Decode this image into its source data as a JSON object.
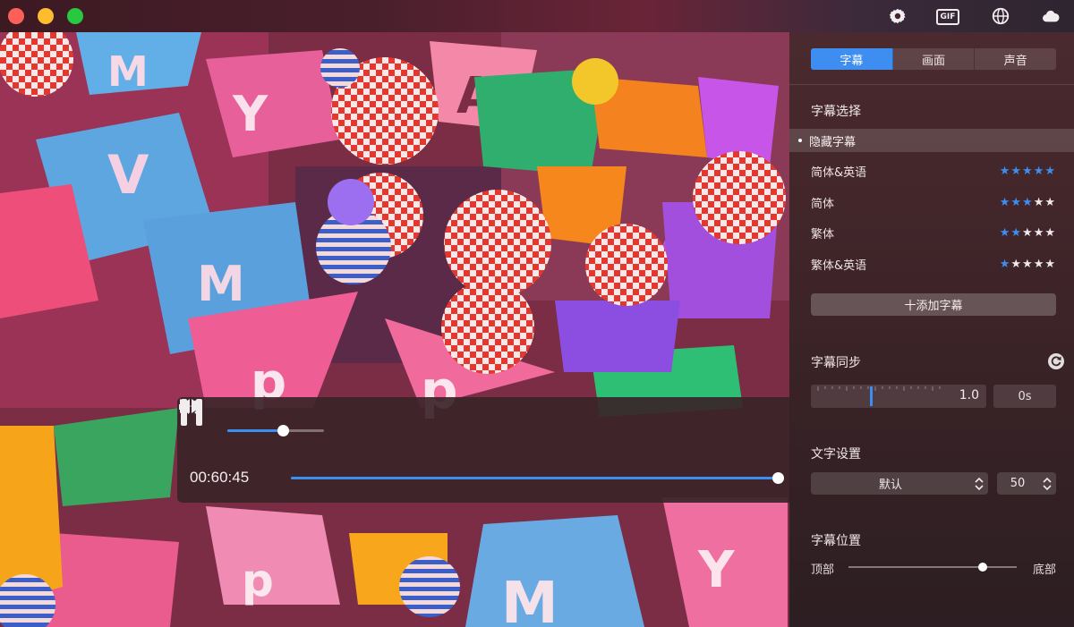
{
  "window": {
    "toolbar_icons": [
      "gear-icon",
      "gif-icon",
      "globe-icon",
      "cloud-icon"
    ],
    "gif_label": "GIF"
  },
  "player": {
    "volume": 0.57,
    "current_time": "00:60:45",
    "progress": 1.0,
    "accent_color": "#3d8ef0"
  },
  "panel": {
    "tabs": [
      {
        "label": "字幕",
        "active": true
      },
      {
        "label": "画面",
        "active": false
      },
      {
        "label": "声音",
        "active": false
      }
    ],
    "subtitle_select": {
      "title": "字幕选择",
      "hidden_option": "隐藏字幕",
      "items": [
        {
          "label": "简体&英语",
          "rating": 5
        },
        {
          "label": "简体",
          "rating": 3
        },
        {
          "label": "繁体",
          "rating": 2
        },
        {
          "label": "繁体&英语",
          "rating": 1
        }
      ],
      "add_button": "十添加字幕"
    },
    "subtitle_sync": {
      "title": "字幕同步",
      "value": "1.0",
      "offset": "0s"
    },
    "text_settings": {
      "title": "文字设置",
      "font": "默认",
      "size": "50"
    },
    "subtitle_position": {
      "title": "字幕位置",
      "left_label": "顶部",
      "right_label": "底部",
      "value": 0.8
    }
  }
}
